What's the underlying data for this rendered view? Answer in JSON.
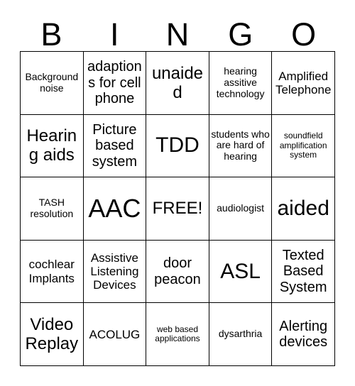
{
  "card": {
    "header_letters": [
      "B",
      "I",
      "N",
      "G",
      "O"
    ],
    "rows": [
      [
        {
          "text": "Background noise",
          "size": "fs-sm"
        },
        {
          "text": "adaptions for cell phone",
          "size": "fs-lg"
        },
        {
          "text": "unaided",
          "size": "fs-xl"
        },
        {
          "text": "hearing assitive technology",
          "size": "fs-sm"
        },
        {
          "text": "Amplified Telephone",
          "size": "fs-md"
        }
      ],
      [
        {
          "text": "Hearing aids",
          "size": "fs-xl"
        },
        {
          "text": "Picture based system",
          "size": "fs-lg"
        },
        {
          "text": "TDD",
          "size": "fs-2xl"
        },
        {
          "text": "students who are hard of hearing",
          "size": "fs-sm"
        },
        {
          "text": "soundfield amplification system",
          "size": "fs-xs"
        }
      ],
      [
        {
          "text": "TASH resolution",
          "size": "fs-sm"
        },
        {
          "text": "AAC",
          "size": "fs-3xl"
        },
        {
          "text": "FREE!",
          "size": "fs-xl"
        },
        {
          "text": "audiologist",
          "size": "fs-sm"
        },
        {
          "text": "aided",
          "size": "fs-2xl"
        }
      ],
      [
        {
          "text": "cochlear Implants",
          "size": "fs-md"
        },
        {
          "text": "Assistive Listening Devices",
          "size": "fs-md"
        },
        {
          "text": "door peacon",
          "size": "fs-lg"
        },
        {
          "text": "ASL",
          "size": "fs-2xl"
        },
        {
          "text": "Texted Based System",
          "size": "fs-lg"
        }
      ],
      [
        {
          "text": "Video Replay",
          "size": "fs-xl"
        },
        {
          "text": "ACOLUG",
          "size": "fs-md"
        },
        {
          "text": "web based applications",
          "size": "fs-xs"
        },
        {
          "text": "dysarthria",
          "size": "fs-sm"
        },
        {
          "text": "Alerting devices",
          "size": "fs-lg"
        }
      ]
    ],
    "free_space_label": "FREE!",
    "colors": {
      "background": "#ffffff",
      "text": "#000000",
      "grid_line": "#000000"
    }
  }
}
